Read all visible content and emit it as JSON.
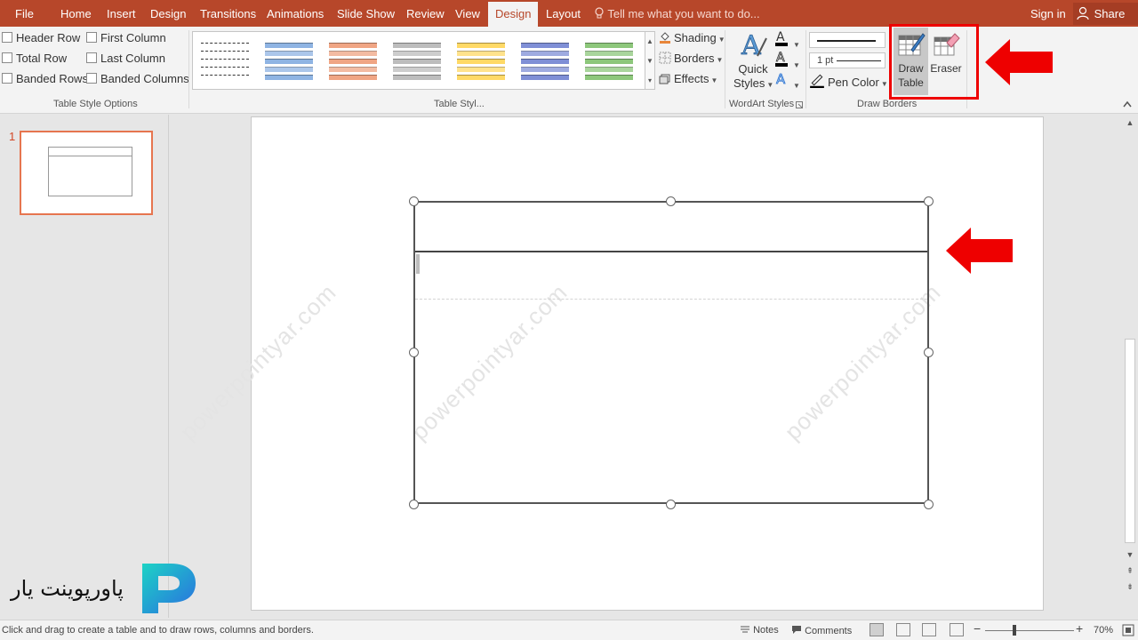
{
  "menu": {
    "tabs": [
      "File",
      "Home",
      "Insert",
      "Design",
      "Transitions",
      "Animations",
      "Slide Show",
      "Review",
      "View",
      "Design",
      "Layout"
    ],
    "active_tab": "Design",
    "tell_me": "Tell me what you want to do...",
    "sign_in": "Sign in",
    "share": "Share"
  },
  "ribbon": {
    "style_options": {
      "header_row": "Header Row",
      "total_row": "Total Row",
      "banded_rows": "Banded Rows",
      "first_column": "First Column",
      "last_column": "Last Column",
      "banded_columns": "Banded Columns",
      "group_label": "Table Style Options"
    },
    "table_styles": {
      "group_label": "Table Styl...",
      "swatch_colors": [
        "#ffffff",
        "#8fb4e3",
        "#f0a584",
        "#bdbdbd",
        "#ffd966",
        "#7f8fd6",
        "#8dc77b"
      ],
      "shading": "Shading",
      "borders": "Borders",
      "effects": "Effects"
    },
    "wordart": {
      "quick_styles_line1": "Quick",
      "quick_styles_line2": "Styles",
      "group_label": "WordArt Styles"
    },
    "draw_borders": {
      "pen_weight": "1 pt",
      "pen_color": "Pen Color",
      "draw_table_line1": "Draw",
      "draw_table_line2": "Table",
      "eraser": "Eraser",
      "group_label": "Draw Borders"
    }
  },
  "slides_pane": {
    "slide_number": "1"
  },
  "slide": {
    "watermark": "powerpointyar.com"
  },
  "logo": {
    "text": "پاورپوینت یار",
    "colors": [
      "#1dd3c5",
      "#2a6de0"
    ]
  },
  "status": {
    "message": "Click and drag to create a table and to draw rows, columns and borders.",
    "notes": "Notes",
    "comments": "Comments",
    "zoom": "70%"
  },
  "colors": {
    "accent": "#b7472a",
    "annotation_red": "#ee0000"
  }
}
